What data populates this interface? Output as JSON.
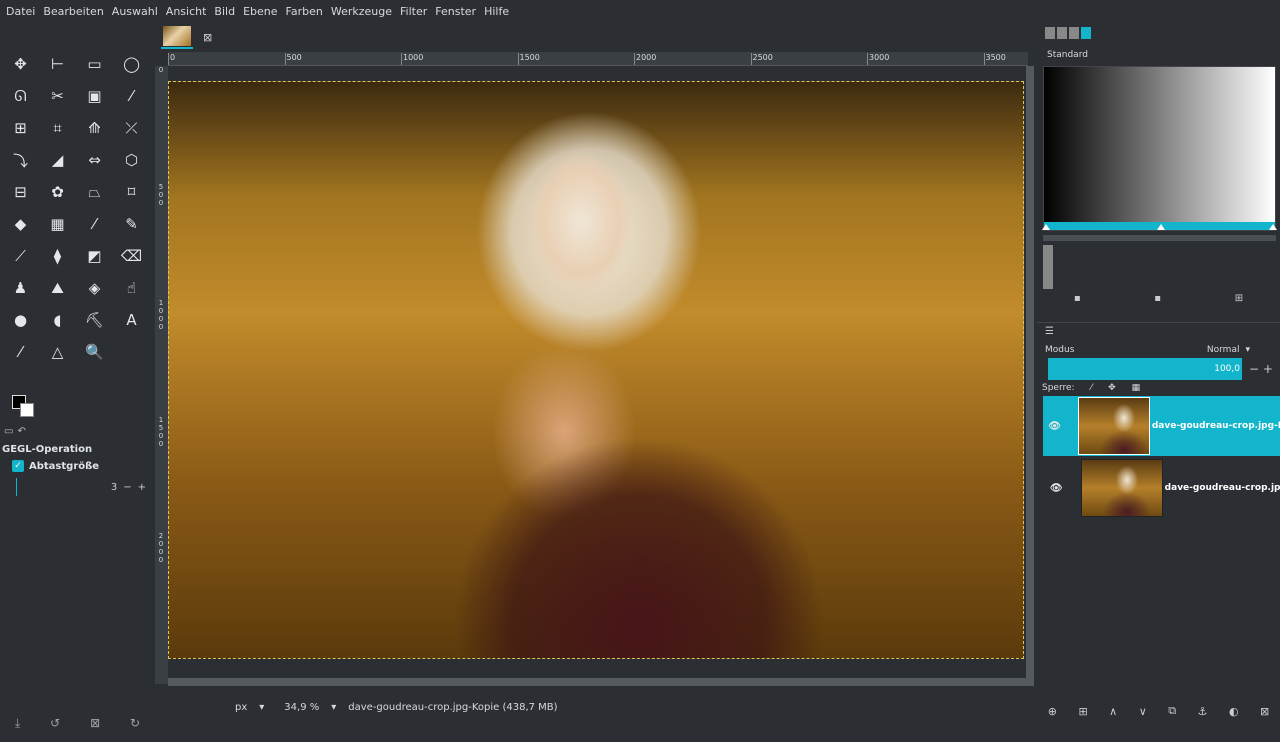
{
  "menu": [
    "Datei",
    "Bearbeiten",
    "Auswahl",
    "Ansicht",
    "Bild",
    "Ebene",
    "Farben",
    "Werkzeuge",
    "Filter",
    "Fenster",
    "Hilfe"
  ],
  "tools": [
    {
      "icon": "move-icon",
      "glyph": "✥"
    },
    {
      "icon": "align-icon",
      "glyph": "⊢"
    },
    {
      "icon": "rect-select-icon",
      "glyph": "▭"
    },
    {
      "icon": "ellipse-select-icon",
      "glyph": "◯"
    },
    {
      "icon": "free-select-icon",
      "glyph": "ᘏ"
    },
    {
      "icon": "scissors-icon",
      "glyph": "✂"
    },
    {
      "icon": "foreground-select-icon",
      "glyph": "▣"
    },
    {
      "icon": "fuzzy-select-icon",
      "glyph": "⁄"
    },
    {
      "icon": "color-select-icon",
      "glyph": "⊞"
    },
    {
      "icon": "crop-icon",
      "glyph": "⌗"
    },
    {
      "icon": "unified-transform-icon",
      "glyph": "⟰"
    },
    {
      "icon": "warp-transform-icon",
      "glyph": "⤫"
    },
    {
      "icon": "flip-icon",
      "glyph": "⤵"
    },
    {
      "icon": "shear-icon",
      "glyph": "◢"
    },
    {
      "icon": "handle-transform-icon",
      "glyph": "⇔"
    },
    {
      "icon": "perspective-icon",
      "glyph": "⬡"
    },
    {
      "icon": "cage-transform-icon",
      "glyph": "⊟"
    },
    {
      "icon": "mypaint-brush-icon",
      "glyph": "✿"
    },
    {
      "icon": "bucket-fill-icon",
      "glyph": "⏢"
    },
    {
      "icon": "n-point-deform-icon",
      "glyph": "⌑"
    },
    {
      "icon": "paint-bucket-icon",
      "glyph": "◆"
    },
    {
      "icon": "blend-icon",
      "glyph": "▦"
    },
    {
      "icon": "paintbrush-icon",
      "glyph": "⁄"
    },
    {
      "icon": "pencil-icon",
      "glyph": "✎"
    },
    {
      "icon": "airbrush-icon",
      "glyph": "⟋"
    },
    {
      "icon": "ink-icon",
      "glyph": "⧫"
    },
    {
      "icon": "smudge-fill-icon",
      "glyph": "◩"
    },
    {
      "icon": "eraser-icon",
      "glyph": "⌫"
    },
    {
      "icon": "clone-icon",
      "glyph": "♟"
    },
    {
      "icon": "heal-icon",
      "glyph": "⛰"
    },
    {
      "icon": "perspective-clone-icon",
      "glyph": "◈"
    },
    {
      "icon": "smudge-icon",
      "glyph": "☝"
    },
    {
      "icon": "dodge-burn-icon",
      "glyph": "●"
    },
    {
      "icon": "blur-icon",
      "glyph": "◖"
    },
    {
      "icon": "paths-icon",
      "glyph": "⛏"
    },
    {
      "icon": "text-icon",
      "glyph": "A"
    },
    {
      "icon": "color-picker-icon",
      "glyph": "⁄"
    },
    {
      "icon": "measure-icon",
      "glyph": "△"
    },
    {
      "icon": "zoom-icon",
      "glyph": "🔍"
    }
  ],
  "tool_options": {
    "title": "GEGL-Operation",
    "sample_size_label": "Abtastgröße",
    "sample_size_value": "3"
  },
  "image_tab": {
    "close": "⊠"
  },
  "ruler_labels": [
    "0",
    "500",
    "1000",
    "1500",
    "2000",
    "2500",
    "3000",
    "3500"
  ],
  "vruler_labels": [
    "0",
    "500",
    "1000",
    "1500",
    "2000"
  ],
  "status": {
    "unit": "px",
    "zoom": "34,9 %",
    "info": "dave-goudreau-crop.jpg-Kopie (438,7 MB)"
  },
  "dock": {
    "gradient_name": "Standard"
  },
  "layers": {
    "mode_label": "Modus",
    "mode_value": "Normal",
    "opacity": "100,0",
    "lock_label": "Sperre:",
    "items": [
      {
        "name": "dave-goudreau-crop.jpg-Kopie",
        "selected": true
      },
      {
        "name": "dave-goudreau-crop.jpg",
        "selected": false
      }
    ]
  },
  "colors": {
    "accent": "#12b5cb",
    "bg": "#2b2f33"
  }
}
